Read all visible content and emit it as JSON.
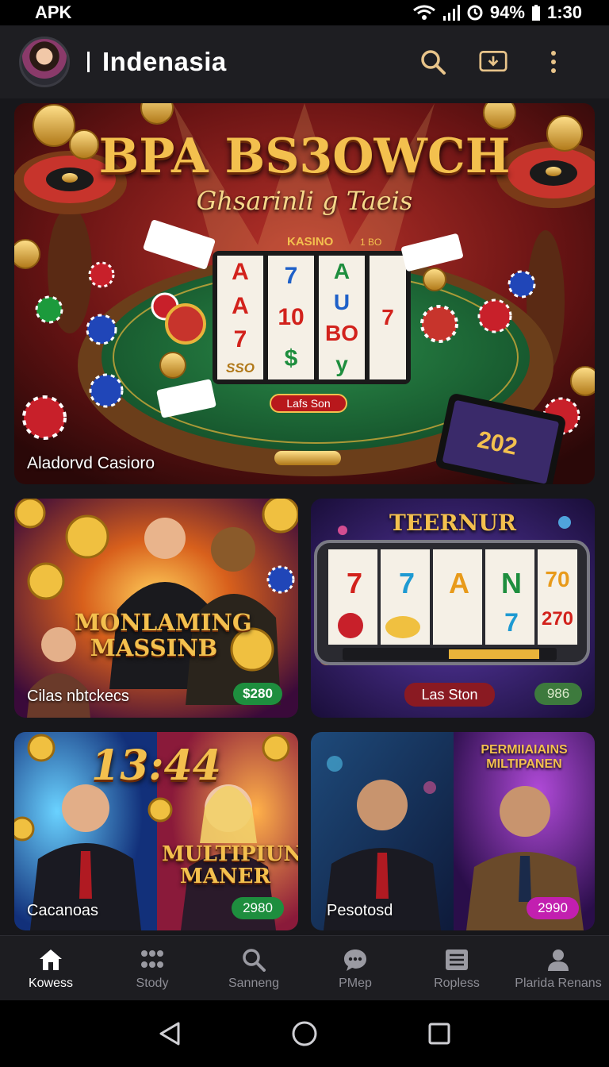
{
  "status_bar": {
    "carrier": "APK",
    "battery": "94%",
    "time": "1:30"
  },
  "header": {
    "title": "Indenasia"
  },
  "hero": {
    "headline": "BPA BS3OWCH",
    "subheadline": "Ghsarinli g Taeis",
    "table_label": "KASINO",
    "table_sub": "1 BO",
    "button": "Lafs Son",
    "tablet_text": "202",
    "reels": [
      [
        "A",
        "A",
        "7",
        "SSO"
      ],
      [
        "7",
        "10",
        "$"
      ],
      [
        "A",
        "U",
        "BO",
        "y"
      ],
      [
        "7",
        "",
        ""
      ]
    ],
    "caption": "Aladorvd Casioro"
  },
  "cards": [
    {
      "headline": "MONLAMING MASSINB",
      "caption": "Cilas nbtckecs",
      "badge": "$280",
      "badge_color": "#1e8e3e"
    },
    {
      "headline": "TEERNUR",
      "reels": [
        "7",
        "7",
        "A",
        "N",
        "70"
      ],
      "reels_row2": [
        "",
        "",
        "",
        "7",
        "270"
      ],
      "button": "Las Ston",
      "badge": "986",
      "badge_color": "#3d7a3d"
    },
    {
      "headline": "13:44",
      "headline2": "MULTIPIUN MANER",
      "caption": "Cacanoas",
      "badge": "2980",
      "badge_color": "#1e8e3e"
    },
    {
      "headline": "PERMIIAIAINS MILTIPANEN",
      "caption": "Pesotosd",
      "badge": "2990",
      "badge_color": "#c21fb0"
    }
  ],
  "nav": {
    "items": [
      {
        "label": "Kowess",
        "icon": "home-icon"
      },
      {
        "label": "Stody",
        "icon": "grid-icon"
      },
      {
        "label": "Sanneng",
        "icon": "search-icon"
      },
      {
        "label": "PMep",
        "icon": "chat-icon"
      },
      {
        "label": "Ropless",
        "icon": "list-icon"
      },
      {
        "label": "Plarida Renans",
        "icon": "profile-icon"
      }
    ]
  },
  "colors": {
    "accent": "#e8b33a",
    "felt": "#1e6a36",
    "background": "#17171b"
  }
}
